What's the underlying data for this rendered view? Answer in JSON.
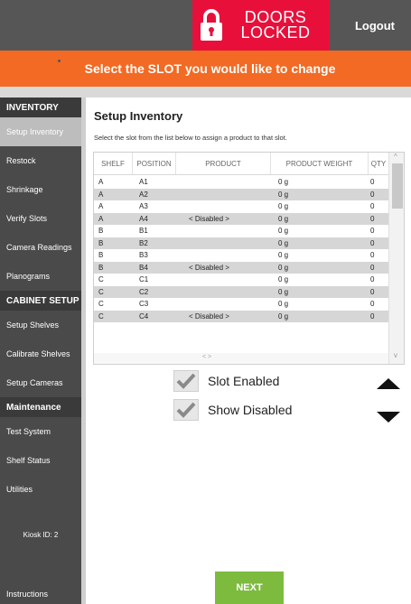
{
  "header": {
    "doors_line1": "DOORS",
    "doors_line2": "LOCKED",
    "logout_label": "Logout",
    "lock_icon": "lock-icon",
    "doors_color": "#e8103b",
    "header_bg": "#565656"
  },
  "banner": {
    "text": "Select the SLOT you would like to change",
    "color": "#f26a24"
  },
  "sidebar": {
    "sections": [
      {
        "title": "INVENTORY",
        "items": [
          "Setup Inventory",
          "Restock",
          "Shrinkage",
          "Verify Slots",
          "Camera Readings",
          "Planograms"
        ]
      },
      {
        "title": "CABINET SETUP",
        "items": [
          "Setup Shelves",
          "Calibrate Shelves",
          "Setup Cameras"
        ]
      },
      {
        "title": "Maintenance",
        "items": [
          "Test System",
          "Shelf Status",
          "Utilities"
        ]
      }
    ],
    "active_item": "Setup Inventory",
    "kiosk_id": "Kiosk ID: 2",
    "instructions": "Instructions"
  },
  "main": {
    "title": "Setup Inventory",
    "description": "Select the slot from the list below to assign a product to that slot.",
    "table": {
      "headers": [
        "SHELF",
        "POSITION",
        "PRODUCT",
        "PRODUCT WEIGHT",
        "QTY"
      ],
      "rows": [
        [
          "A",
          "A1",
          "",
          "0 g",
          "0"
        ],
        [
          "A",
          "A2",
          "",
          "0 g",
          "0"
        ],
        [
          "A",
          "A3",
          "",
          "0 g",
          "0"
        ],
        [
          "A",
          "A4",
          "< Disabled >",
          "0 g",
          "0"
        ],
        [
          "B",
          "B1",
          "",
          "0 g",
          "0"
        ],
        [
          "B",
          "B2",
          "",
          "0 g",
          "0"
        ],
        [
          "B",
          "B3",
          "",
          "0 g",
          "0"
        ],
        [
          "B",
          "B4",
          "< Disabled >",
          "0 g",
          "0"
        ],
        [
          "C",
          "C1",
          "",
          "0 g",
          "0"
        ],
        [
          "C",
          "C2",
          "",
          "0 g",
          "0"
        ],
        [
          "C",
          "C3",
          "",
          "0 g",
          "0"
        ],
        [
          "C",
          "C4",
          "< Disabled >",
          "0 g",
          "0"
        ]
      ]
    },
    "checkboxes": [
      {
        "label": "Slot Enabled",
        "checked": true
      },
      {
        "label": "Show Disabled",
        "checked": true
      }
    ],
    "next_label": "NEXT",
    "next_color": "#7dbb3f"
  }
}
